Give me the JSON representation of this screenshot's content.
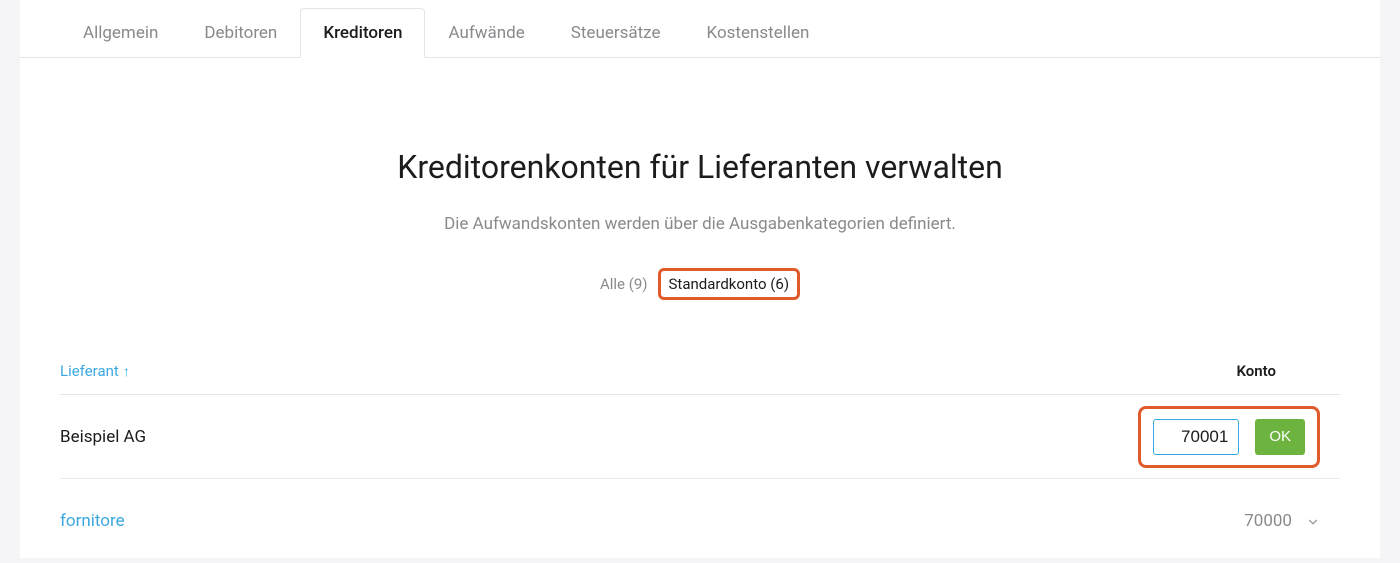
{
  "tabs": [
    {
      "label": "Allgemein",
      "active": false
    },
    {
      "label": "Debitoren",
      "active": false
    },
    {
      "label": "Kreditoren",
      "active": true
    },
    {
      "label": "Aufwände",
      "active": false
    },
    {
      "label": "Steuersätze",
      "active": false
    },
    {
      "label": "Kostenstellen",
      "active": false
    }
  ],
  "page": {
    "title": "Kreditorenkonten für Lieferanten verwalten",
    "subtitle": "Die Aufwandskonten werden über die Ausgabenkategorien definiert."
  },
  "filters": {
    "all": "Alle (9)",
    "standard": "Standardkonto (6)"
  },
  "table": {
    "headers": {
      "lieferant": "Lieferant",
      "konto": "Konto"
    },
    "sort_arrow": "↑",
    "rows": [
      {
        "name": "Beispiel AG",
        "konto": "70001",
        "editing": true,
        "link": false
      },
      {
        "name": "fornitore",
        "konto": "70000",
        "editing": false,
        "link": true
      }
    ]
  },
  "buttons": {
    "ok": "OK"
  }
}
